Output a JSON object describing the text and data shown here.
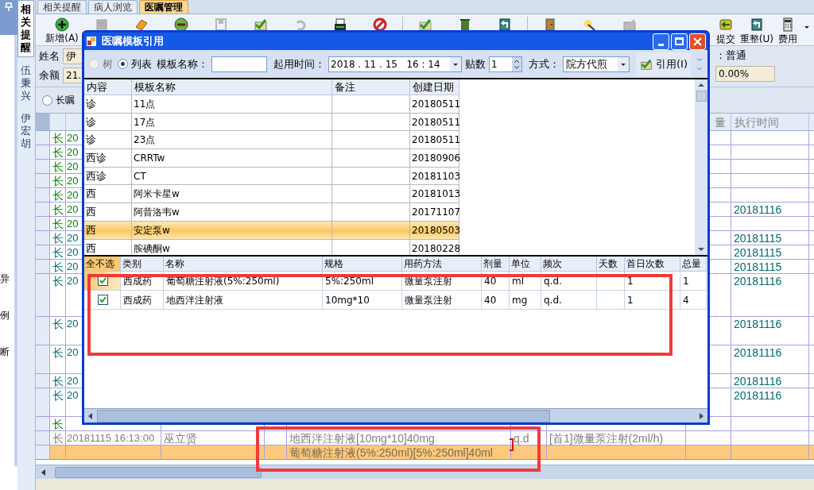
{
  "left_panel": {
    "texts": [
      "异",
      "例",
      "断"
    ]
  },
  "vertical_tabs": [
    {
      "label": "相关提醒",
      "selected": true
    },
    {
      "label": "伍秉兴",
      "selected": false
    },
    {
      "label": "伊宏胡",
      "selected": false
    }
  ],
  "tabs": [
    {
      "label": "相关提醒",
      "selected": false
    },
    {
      "label": "病人浏览",
      "selected": false
    },
    {
      "label": "医嘱管理",
      "selected": true
    }
  ],
  "toolbar": [
    {
      "label": "新增(A)",
      "disabled": false
    },
    {
      "disabled": true
    },
    {
      "disabled": false
    },
    {
      "disabled": false
    },
    {
      "disabled": true
    },
    {
      "disabled": false
    },
    {
      "disabled": true
    },
    {
      "disabled": false
    },
    {
      "disabled": false
    },
    {
      "disabled": false
    },
    {
      "disabled": false
    },
    {
      "disabled": false
    },
    {
      "disabled": false
    },
    {
      "disabled": false
    },
    {
      "disabled": true
    }
  ],
  "toolbar_right": [
    {
      "label": "提交"
    },
    {
      "label": "重整(U)"
    },
    {
      "label": "费用"
    }
  ],
  "patient": {
    "name_label": "姓名",
    "name_value": "伊",
    "balance_label": "余额",
    "balance_value": "21.",
    "type_label": "：普通",
    "ratio": "0.00%"
  },
  "order_type": {
    "label": "长嘱",
    "selected": false
  },
  "orders": {
    "columns": [
      "量",
      "执行时间"
    ],
    "rows": [
      {
        "kind": "长",
        "date": "20",
        "color": "#008000",
        "selected": false
      },
      {
        "kind": "长",
        "date": "20",
        "color": "#008000",
        "selected": false
      },
      {
        "kind": "长",
        "date": "20",
        "color": "#008000",
        "selected": false
      },
      {
        "kind": "长",
        "date": "20",
        "color": "#008000",
        "selected": false
      },
      {
        "kind": "长",
        "date": "20",
        "color": "#008000",
        "selected": false
      },
      {
        "kind": "长",
        "date": "20",
        "color": "#008000",
        "selected": false,
        "exec": "20181116"
      },
      {
        "kind": "长",
        "date": "20",
        "color": "#008000",
        "selected": false
      },
      {
        "kind": "长",
        "date": "20",
        "color": "#006a6a",
        "selected": false,
        "exec": "20181115"
      },
      {
        "kind": "长",
        "date": "20",
        "color": "#006a6a",
        "selected": false,
        "exec": "20181115"
      },
      {
        "kind": "长",
        "date": "20",
        "color": "#006a6a",
        "selected": false,
        "exec": "20181115"
      },
      {
        "kind": "长",
        "date": "20",
        "color": "#006a6a",
        "selected": false,
        "exec": "20181116"
      },
      {
        "kind": "长",
        "date": "20",
        "color": "#006a6a",
        "selected": false,
        "exec": "20181116"
      },
      {
        "kind": "长",
        "date": "20",
        "color": "#006a6a",
        "selected": false,
        "exec": "20181116"
      },
      {
        "kind": "长",
        "date": "20",
        "color": "#006a6a",
        "selected": false,
        "exec": "20181116"
      },
      {
        "kind": "长",
        "date": "20",
        "color": "#006a6a",
        "selected": false,
        "exec": "20181116"
      },
      {
        "kind": "长",
        "color": "#008000",
        "selected": false
      },
      {
        "kind": "长",
        "date": "20181115 16:13:00",
        "doctor": "巫立贤",
        "content": "地西泮注射液[10mg*10]40mg",
        "freq": "q.d",
        "route": "[首1]微量泵注射(2ml/h)",
        "color": "#808080",
        "selected": false
      },
      {
        "content": "葡萄糖注射液(5%:250ml)[5%:250ml]40ml",
        "selected": true
      }
    ]
  },
  "dialog": {
    "title": "医嘱模板引用",
    "view_options": [
      {
        "label": "树",
        "selected": false,
        "disabled": true
      },
      {
        "label": "列表",
        "selected": true,
        "disabled": false
      }
    ],
    "template_name_label": "模板名称：",
    "start_time_label": "起用时间：",
    "start_time": "2018 . 11 . 15   16 : 14",
    "doses_label": "贴数",
    "doses": "1",
    "method_label": "方式：",
    "method": "院方代煎",
    "quote_button": "引用(I)",
    "templates": {
      "columns": [
        "内容",
        "模板名称",
        "备注",
        "创建日期"
      ],
      "rows": [
        {
          "content": "诊",
          "name": "11点",
          "date": "20180511",
          "selected": false
        },
        {
          "content": "诊",
          "name": "17点",
          "date": "20180511",
          "selected": false
        },
        {
          "content": "诊",
          "name": "23点",
          "date": "20180511",
          "selected": false
        },
        {
          "content": "西诊",
          "name": "CRRTw",
          "date": "20180906",
          "selected": false
        },
        {
          "content": "西诊",
          "name": "CT",
          "date": "20181103",
          "selected": false
        },
        {
          "content": "西",
          "name": "阿米卡星w",
          "date": "20181013",
          "selected": false
        },
        {
          "content": "西",
          "name": "阿昔洛韦w",
          "date": "20171107",
          "selected": false
        },
        {
          "content": "西",
          "name": "安定泵w",
          "date": "20180503",
          "selected": true
        },
        {
          "content": "西",
          "name": "胺碘酮w",
          "date": "20180228",
          "selected": false
        }
      ]
    },
    "items": {
      "columns": [
        "全不选",
        "类别",
        "名称",
        "规格",
        "用药方法",
        "剂量",
        "单位",
        "频次",
        "天数",
        "首日次数",
        "总量"
      ],
      "rows": [
        {
          "checked": true,
          "current": true,
          "category": "西成药",
          "name": "葡萄糖注射液(5%:250ml)",
          "spec": "5%:250ml",
          "usage": "微量泵注射",
          "dose": "40",
          "unit": "ml",
          "freq": "q.d.",
          "first_day": "1",
          "total": "1"
        },
        {
          "checked": true,
          "current": false,
          "category": "西成药",
          "name": "地西泮注射液",
          "spec": "10mg*10",
          "usage": "微量泵注射",
          "dose": "40",
          "unit": "mg",
          "freq": "q.d.",
          "first_day": "1",
          "total": "4"
        }
      ]
    }
  }
}
